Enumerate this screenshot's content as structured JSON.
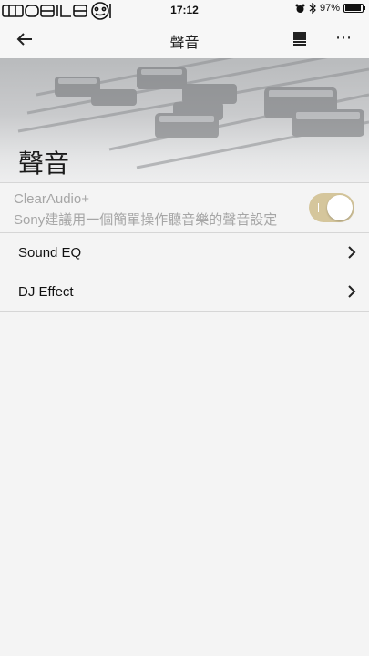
{
  "status_bar": {
    "carrier_logo": "MOBILE01",
    "time": "17:12",
    "battery_percent": "97%",
    "battery_level": 0.97,
    "icons": [
      "alarm-icon",
      "bluetooth-icon",
      "battery-icon"
    ]
  },
  "header": {
    "title": "聲音",
    "icons": [
      "back-arrow-icon",
      "queue-icon",
      "more-icon"
    ]
  },
  "hero": {
    "title": "聲音"
  },
  "clear_audio": {
    "title": "ClearAudio+",
    "description": "Sony建議用一個簡單操作聽音樂的聲音設定",
    "enabled": true,
    "toggle_color": "#d5c69c"
  },
  "menu": {
    "items": [
      {
        "label": "Sound EQ"
      },
      {
        "label": "DJ Effect"
      }
    ]
  },
  "colors": {
    "background": "#f4f4f4",
    "divider": "#d6d6d6",
    "muted_text": "#a6a6a6"
  }
}
